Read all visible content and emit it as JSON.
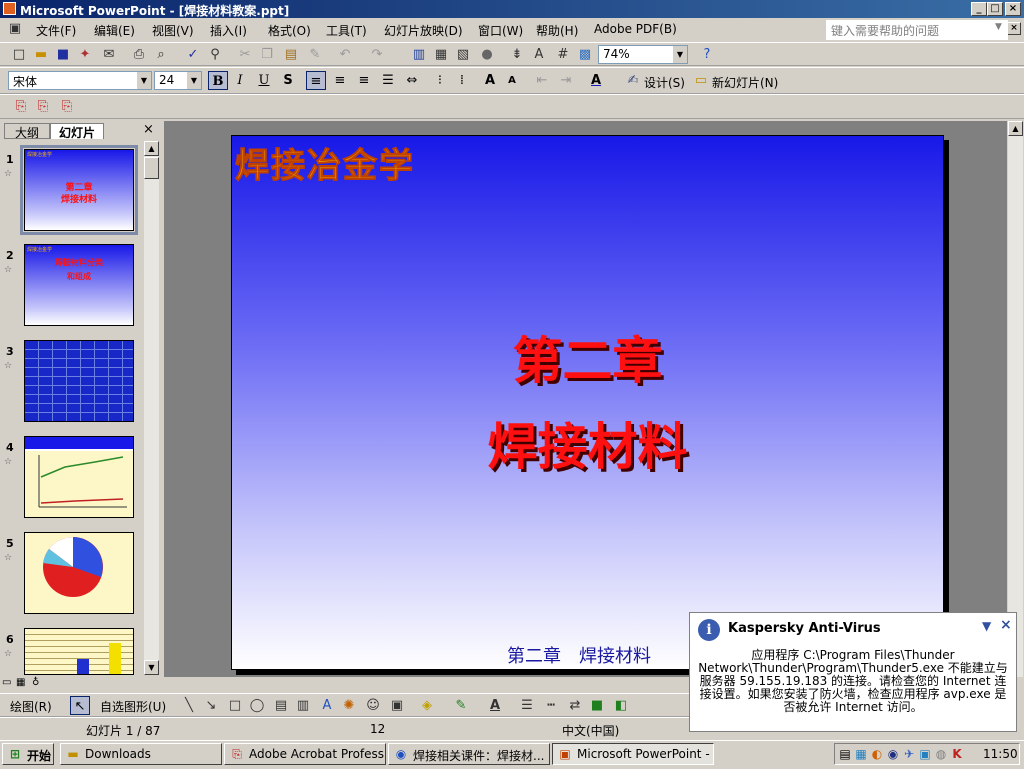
{
  "window": {
    "title": "Microsoft PowerPoint - [焊接材料教案.ppt]"
  },
  "menu": [
    "文件(F)",
    "编辑(E)",
    "视图(V)",
    "插入(I)",
    "格式(O)",
    "工具(T)",
    "幻灯片放映(D)",
    "窗口(W)",
    "帮助(H)",
    "Adobe PDF(B)"
  ],
  "help_box": {
    "placeholder": "键入需要帮助的问题"
  },
  "standard_toolbar": {
    "zoom": "74%"
  },
  "formatting_toolbar": {
    "font": "宋体",
    "font_size": "24",
    "bold": "B",
    "italic": "I",
    "underline": "U",
    "shadow": "S",
    "design_label": "设计(S)",
    "new_slide_label": "新幻灯片(N)"
  },
  "pane_tabs": {
    "outline": "大纲",
    "slides": "幻灯片"
  },
  "thumbnails": [
    {
      "num": "1",
      "brand": "焊接冶金学",
      "line1": "第二章",
      "line2": "焊接材料"
    },
    {
      "num": "2",
      "brand": "焊接冶金学",
      "line1": "焊接材料分类",
      "line2": "和组成"
    },
    {
      "num": "3"
    },
    {
      "num": "4"
    },
    {
      "num": "5"
    },
    {
      "num": "6"
    }
  ],
  "slide": {
    "brand": "焊接冶金学",
    "chapter": "第二章",
    "subtitle": "焊接材料",
    "footer": "第二章　焊接材料"
  },
  "drawing_toolbar": {
    "draw_label": "绘图(R)",
    "autoshapes_label": "自选图形(U)"
  },
  "status": {
    "slide_info": "幻灯片 1 / 87",
    "design": "12",
    "language": "中文(中国)"
  },
  "kaspersky": {
    "title": "Kaspersky Anti-Virus",
    "message": "应用程序 C:\\Program Files\\Thunder Network\\Thunder\\Program\\Thunder5.exe 不能建立与服务器 59.155.19.183 的连接。请检查您的 Internet 连接设置。如果您安装了防火墙，检查应用程序 avp.exe 是否被允许 Internet 访问。"
  },
  "taskbar": {
    "start": "开始",
    "tasks": [
      "Downloads",
      "Adobe Acrobat Professio...",
      "焊接相关课件：焊接材...",
      "Microsoft PowerPoint - [..."
    ],
    "clock": "11:50"
  }
}
